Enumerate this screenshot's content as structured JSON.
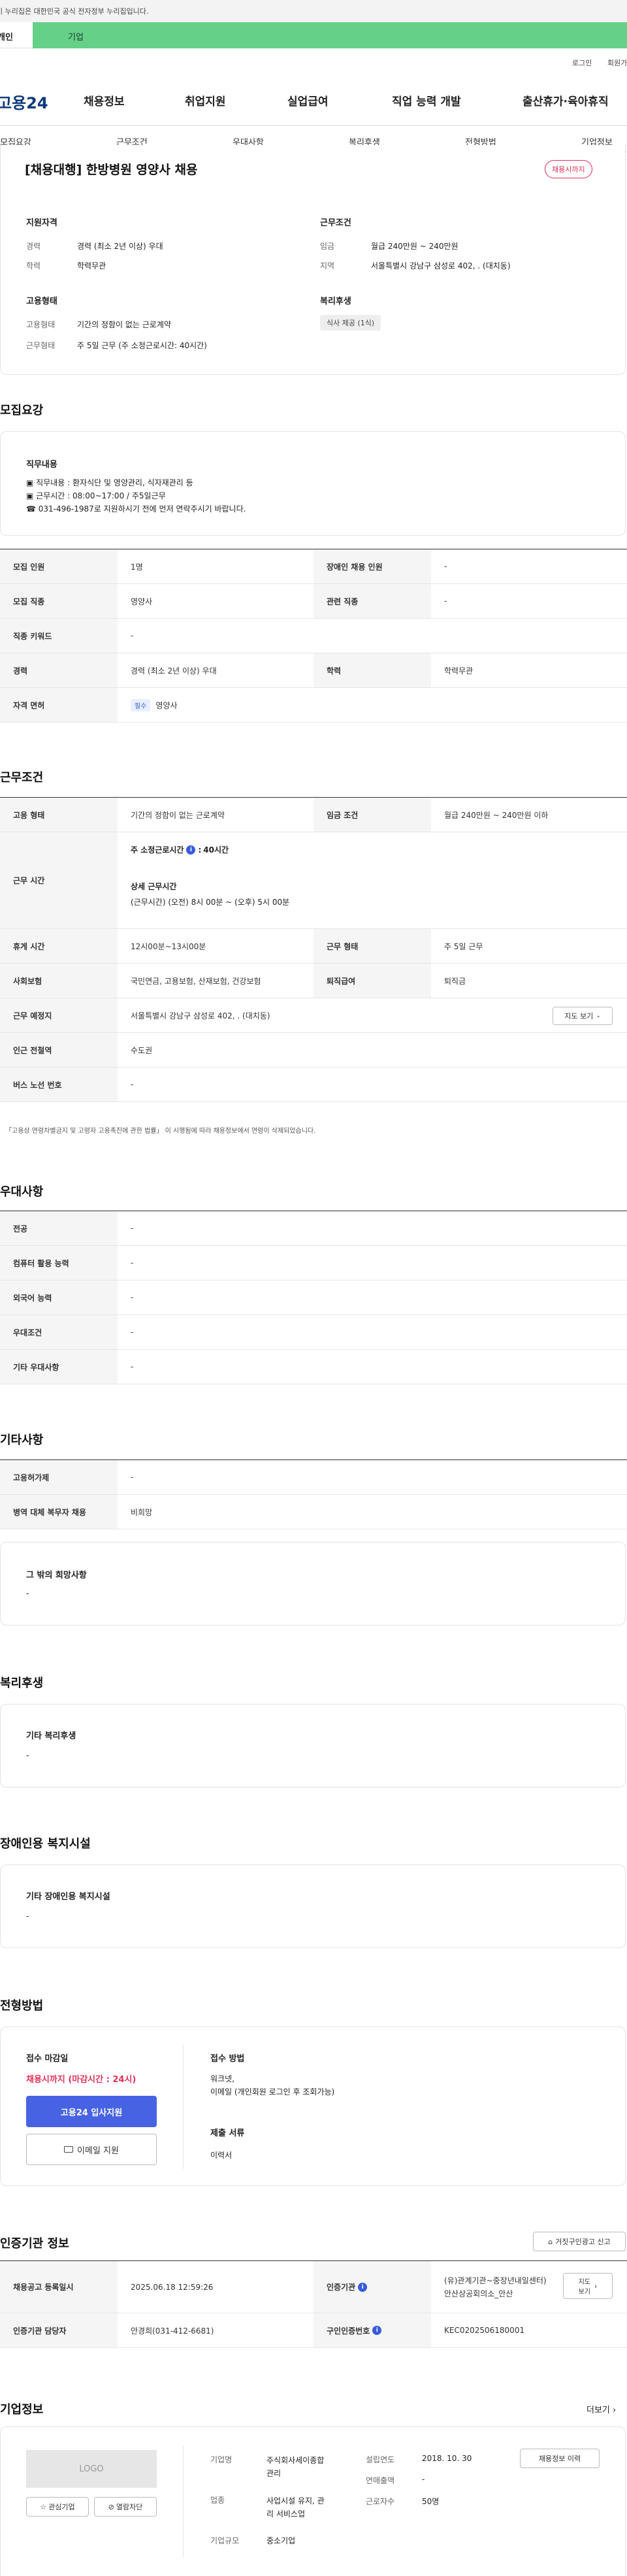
{
  "gov_banner": "이 누리집은 대한민국 공식 전자정부 누리집입니다.",
  "usertype_tabs": [
    "개인",
    "기업"
  ],
  "util_links": [
    "로그인",
    "회원가입"
  ],
  "logo": "고용24",
  "main_nav": [
    "채용정보",
    "취업지원",
    "실업급여",
    "직업 능력 개발",
    "출산휴가·육아휴직"
  ],
  "anchor_tabs": [
    "모집요강",
    "근무조건",
    "우대사항",
    "복리후생",
    "전형방법",
    "기업정보"
  ],
  "summary": {
    "title": "[채용대행] 한방병원 영양사 채용",
    "status_badge": "채용시까지",
    "qual_title": "지원자격",
    "exp_label": "경력",
    "exp_value": "경력 (최소 2년 이상) 우대",
    "edu_label": "학력",
    "edu_value": "학력무관",
    "cond_title": "근무조건",
    "wage_label": "임금",
    "wage_value": "월급 240만원 ~ 240만원",
    "region_label": "지역",
    "region_value": "서울특별시 강남구 삼성로 402, . (대치동)",
    "emp_title": "고용형태",
    "emp_label": "고용형태",
    "emp_value": "기간의 정함이 없는 근로계약",
    "hours_label": "근무형태",
    "hours_value": "주 5일 근무 (주 소정근로시간: 40시간)",
    "welfare_title": "복리후생",
    "welfare_tag": "식사 제공 (1식)"
  },
  "recruit": {
    "title": "모집요강",
    "duty_title": "직무내용",
    "duty_lines": [
      "▣ 직무내용 : 환자식단 및 영양관리, 식자재관리 등",
      "▣ 근무시간 : 08:00~17:00 / 주5일근무",
      "☎ 031-496-1987로 지원하시기 전에  먼저 연락주시기 바랍니다."
    ],
    "rows": [
      {
        "l1": "모집 인원",
        "v1": "1명",
        "l2": "장애인 채용 인원",
        "v2": "-"
      },
      {
        "l1": "모집 직종",
        "v1": "영양사",
        "l2": "관련 직종",
        "v2": "-"
      },
      {
        "l1": "직종 키워드",
        "v1": "-"
      },
      {
        "l1": "경력",
        "v1": "경력 (최소 2년 이상) 우대",
        "l2": "학력",
        "v2": "학력무관"
      },
      {
        "l1": "자격 면허",
        "badge": "필수",
        "v1": "영양사"
      }
    ]
  },
  "work": {
    "title": "근무조건",
    "emp_type_label": "고용 형태",
    "emp_type_value": "기간의 정함이 없는 근로계약",
    "wage_label": "임금 조건",
    "wage_value": "월급 240만원 ~ 240만원 이하",
    "time_label": "근무 시간",
    "weekly_label": "주 소정근로시간",
    "weekly_value": "40시간",
    "detail_label": "상세 근무시간",
    "detail_value": "(근무시간) (오전) 8시 00분 ~ (오후) 5시 00분",
    "break_label": "휴게 시간",
    "break_value": "12시00분~13시00분",
    "form_label": "근무 형태",
    "form_value": "주 5일 근무",
    "insurance_label": "사회보험",
    "insurance_value": "국민연금, 고용보험, 산재보험, 건강보험",
    "severance_label": "퇴직급여",
    "severance_value": "퇴직금",
    "place_label": "근무 예정지",
    "place_value": "서울특별시 강남구 삼성로 402, . (대치동)",
    "map_button": "지도 보기",
    "subway_label": "인근 전철역",
    "subway_value": "수도권",
    "bus_label": "버스 노선 번호",
    "bus_value": "-",
    "note": "「고용상 연령차별금지 및 고령자 고용촉진에 관한 법률」 이 시행됨에 따라 채용정보에서 연령이 삭제되었습니다."
  },
  "pref": {
    "title": "우대사항",
    "rows": [
      {
        "l": "전공",
        "v": "-"
      },
      {
        "l": "컴퓨터 활용 능력",
        "v": "-"
      },
      {
        "l": "외국어 능력",
        "v": "-"
      },
      {
        "l": "우대조건",
        "v": "-"
      },
      {
        "l": "기타 우대사항",
        "v": "-"
      }
    ]
  },
  "etc": {
    "title": "기타사항",
    "rows": [
      {
        "l": "고용허가제",
        "v": "-"
      },
      {
        "l": "병역 대체 복무자 채용",
        "v": "비희망"
      }
    ],
    "box_title": "그 밖의 희망사항",
    "box_value": "-"
  },
  "welfare": {
    "title": "복리후생",
    "box_title": "기타 복리후생",
    "box_value": "-"
  },
  "disabled": {
    "title": "장애인용 복지시설",
    "box_title": "기타 장애인용 복지시설",
    "box_value": "-"
  },
  "method": {
    "title": "전형방법",
    "deadline_title": "접수 마감일",
    "deadline_value": "채용시까지 (마감시간 : 24시)",
    "apply_button": "고용24 입사지원",
    "email_button": "이메일 지원",
    "receipt_title": "접수 방법",
    "receipt_value": "워크넷,\n이메일 (개인회원 로그인 후 조회가능)",
    "docs_title": "제출 서류",
    "docs_value": "이력서"
  },
  "cert": {
    "title": "인증기관 정보",
    "report_button": "거짓구인광고 신고",
    "reg_label": "채용공고 등록일시",
    "reg_value": "2025.06.18 12:59:26",
    "org_label": "인증기관",
    "org_value": "(유)관계기관~중장년내일센터)\n안산상공회의소_안산",
    "map_button": "지도\n보기",
    "manager_label": "인증기관 담당자",
    "manager_value": "안경희(031-412-6681)",
    "certno_label": "구인인증번호",
    "certno_value": "KEC0202506180001"
  },
  "company": {
    "title": "기업정보",
    "more": "더보기",
    "logo_text": "LOGO",
    "fav_button": "관심기업",
    "block_button": "열람차단",
    "name_label": "기업명",
    "name_value": "주식회사세이종합\n관리",
    "industry_label": "업종",
    "industry_value": "사업시설 유지, 관\n리 서비스업",
    "scale_label": "기업규모",
    "scale_value": "중소기업",
    "founded_label": "설립연도",
    "founded_value": "2018. 10. 30",
    "sales_label": "연매출액",
    "sales_value": "-",
    "workers_label": "근로자수",
    "workers_value": "50명",
    "history_button": "채용정보 이력"
  }
}
